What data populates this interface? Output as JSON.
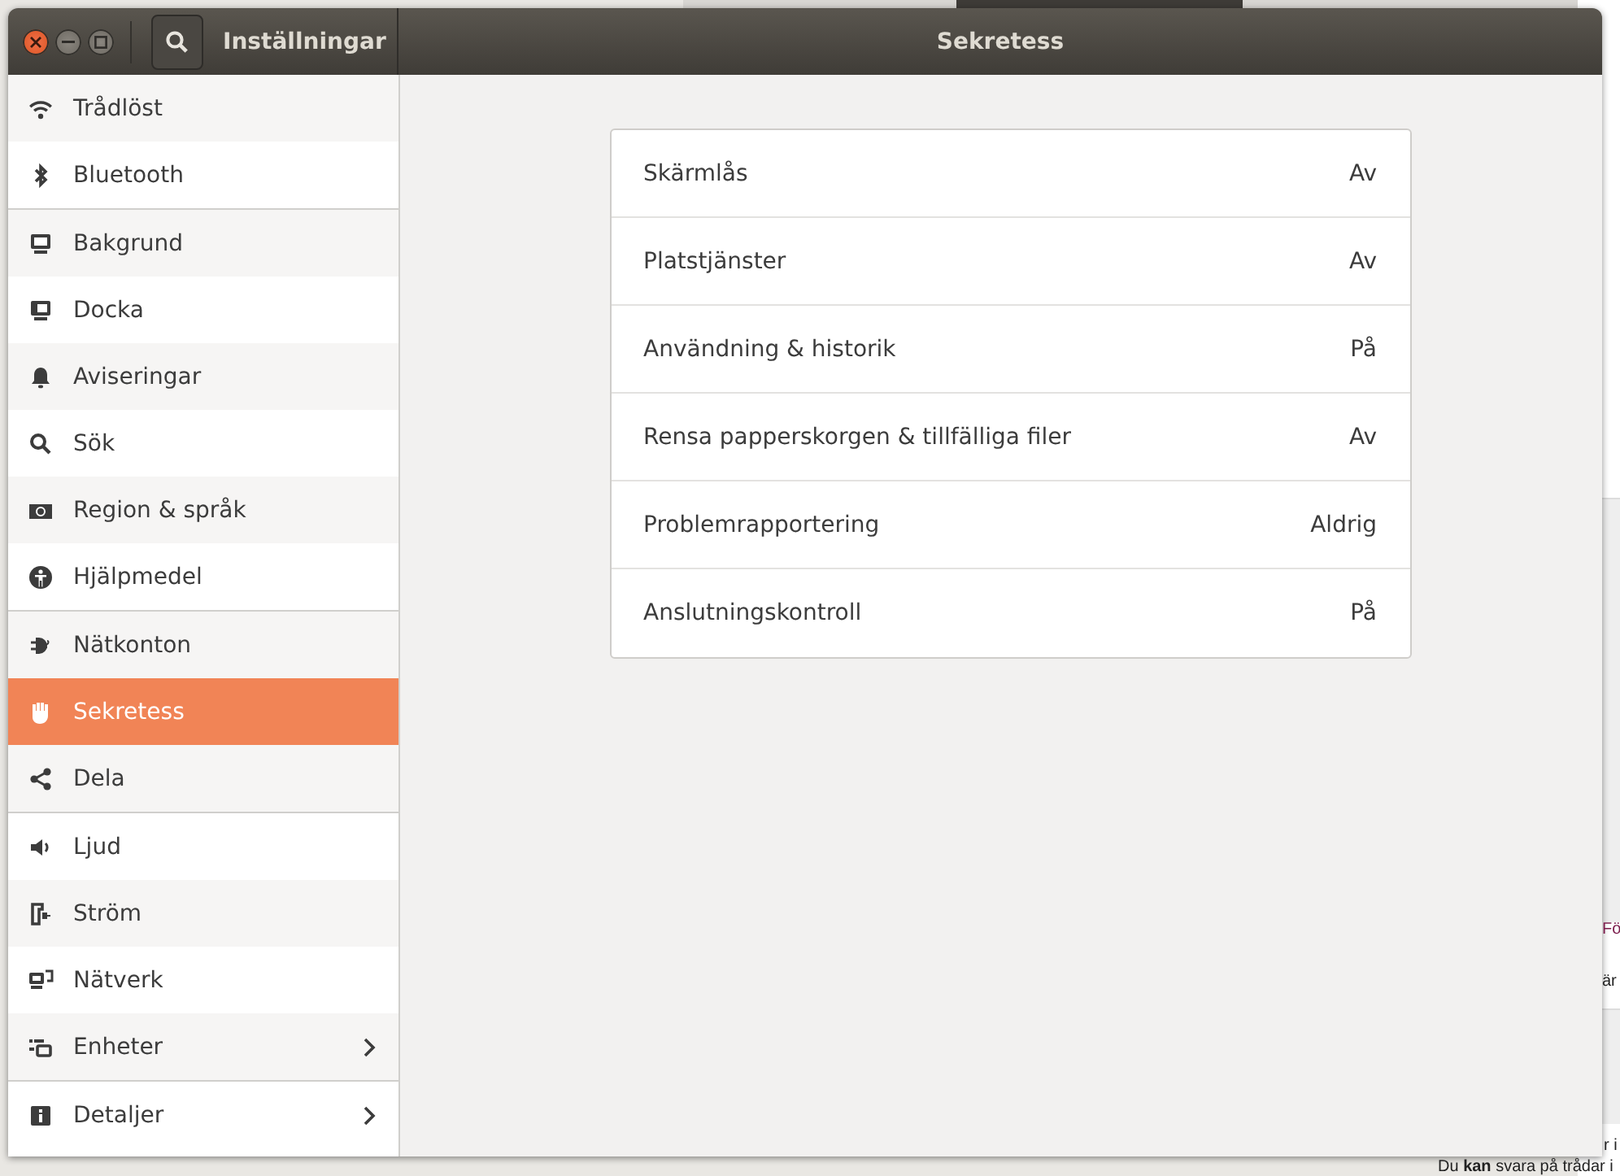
{
  "window": {
    "title": "Inställningar",
    "page_title": "Sekretess"
  },
  "sidebar": {
    "items": [
      {
        "label": "Trådlöst",
        "selected": false,
        "submenu": false,
        "group_end": false
      },
      {
        "label": "Bluetooth",
        "selected": false,
        "submenu": false,
        "group_end": true
      },
      {
        "label": "Bakgrund",
        "selected": false,
        "submenu": false,
        "group_end": false
      },
      {
        "label": "Docka",
        "selected": false,
        "submenu": false,
        "group_end": false
      },
      {
        "label": "Aviseringar",
        "selected": false,
        "submenu": false,
        "group_end": false
      },
      {
        "label": "Sök",
        "selected": false,
        "submenu": false,
        "group_end": false
      },
      {
        "label": "Region & språk",
        "selected": false,
        "submenu": false,
        "group_end": false
      },
      {
        "label": "Hjälpmedel",
        "selected": false,
        "submenu": false,
        "group_end": true
      },
      {
        "label": "Nätkonton",
        "selected": false,
        "submenu": false,
        "group_end": false
      },
      {
        "label": "Sekretess",
        "selected": true,
        "submenu": false,
        "group_end": false
      },
      {
        "label": "Dela",
        "selected": false,
        "submenu": false,
        "group_end": true
      },
      {
        "label": "Ljud",
        "selected": false,
        "submenu": false,
        "group_end": false
      },
      {
        "label": "Ström",
        "selected": false,
        "submenu": false,
        "group_end": false
      },
      {
        "label": "Nätverk",
        "selected": false,
        "submenu": false,
        "group_end": false
      },
      {
        "label": "Enheter",
        "selected": false,
        "submenu": true,
        "group_end": true
      },
      {
        "label": "Detaljer",
        "selected": false,
        "submenu": true,
        "group_end": false
      }
    ]
  },
  "privacy": {
    "rows": [
      {
        "label": "Skärmlås",
        "value": "Av"
      },
      {
        "label": "Platstjänster",
        "value": "Av"
      },
      {
        "label": "Användning & historik",
        "value": "På"
      },
      {
        "label": "Rensa papperskorgen & tillfälliga filer",
        "value": "Av"
      },
      {
        "label": "Problemrapportering",
        "value": "Aldrig"
      },
      {
        "label": "Anslutningskontroll",
        "value": "På"
      }
    ]
  },
  "background_page": {
    "texts": [
      "Fö",
      "är",
      "r i",
      "Du **kan** svara på trådar i"
    ]
  }
}
